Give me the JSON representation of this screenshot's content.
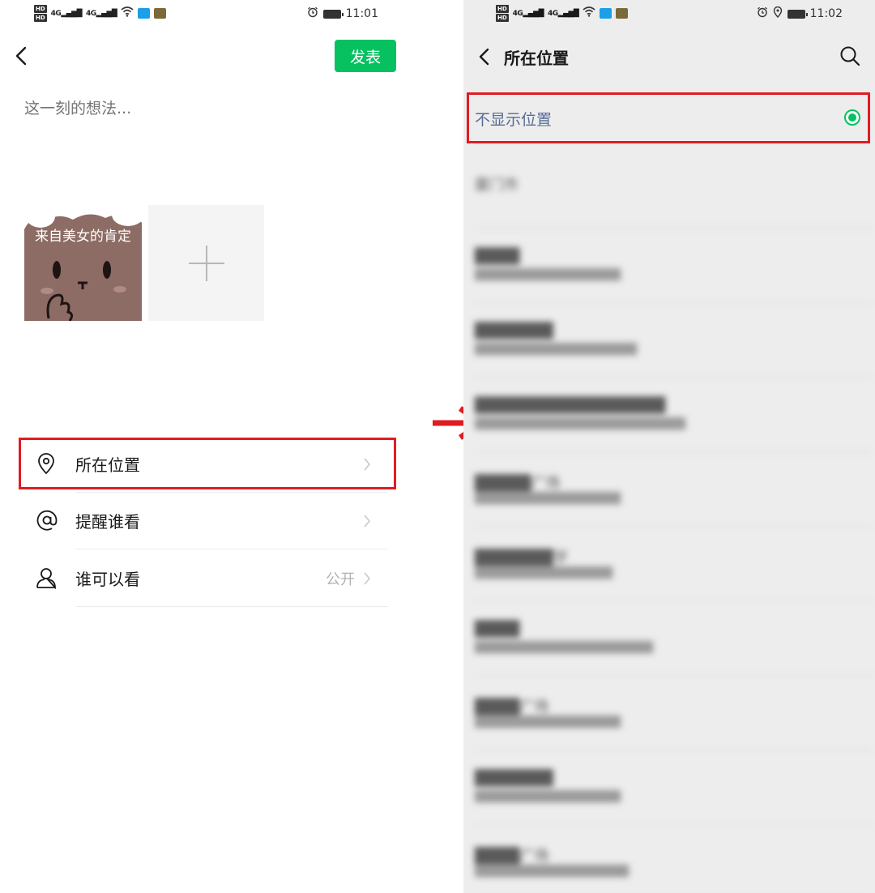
{
  "left_screen": {
    "status_bar": {
      "time": "11:01",
      "network": [
        "4G",
        "4G"
      ]
    },
    "publish_button": "发表",
    "thought_input": {
      "placeholder": "这一刻的想法..."
    },
    "photo": {
      "caption": "来自美女的肯定"
    },
    "menu": [
      {
        "label": "所在位置",
        "value": "",
        "icon": "location-pin-icon"
      },
      {
        "label": "提醒谁看",
        "value": "",
        "icon": "at-sign-icon"
      },
      {
        "label": "谁可以看",
        "value": "公开",
        "icon": "person-icon"
      }
    ]
  },
  "right_screen": {
    "status_bar": {
      "time": "11:02",
      "network": [
        "4G",
        "4G"
      ]
    },
    "title": "所在位置",
    "no_location_option": "不显示位置",
    "locations": [
      {
        "name": "厦门市",
        "address": ""
      },
      {
        "name": "████",
        "address": "██████████████████"
      },
      {
        "name": "███████",
        "address": "████████████████████"
      },
      {
        "name": "█████████████████",
        "address": "██████████████████████████"
      },
      {
        "name": "█████广场",
        "address": "██████████████████"
      },
      {
        "name": "███████学",
        "address": "█████████████████"
      },
      {
        "name": "████",
        "address": "██████████████████████"
      },
      {
        "name": "████广场",
        "address": "██████████████████"
      },
      {
        "name": "███████",
        "address": "██████████████████"
      },
      {
        "name": "████广场",
        "address": "███████████████████"
      }
    ]
  },
  "colors": {
    "brand_green": "#07c160",
    "highlight_red": "#e11b22",
    "link_blue": "#576b95"
  }
}
